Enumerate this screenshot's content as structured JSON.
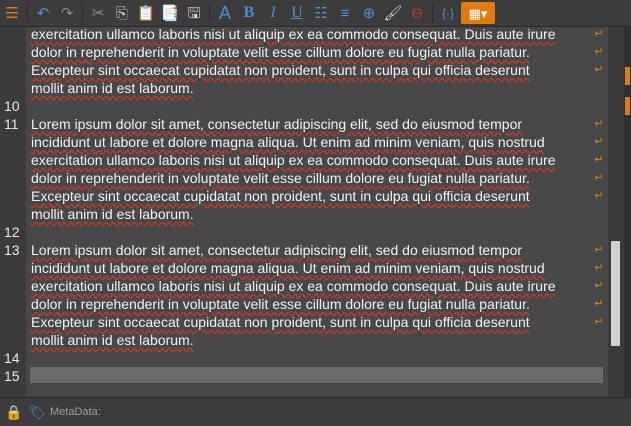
{
  "toolbar": {
    "items": [
      {
        "name": "menu-icon",
        "glyph": "☰"
      },
      {
        "name": "undo-icon",
        "glyph": "↶"
      },
      {
        "name": "redo-icon",
        "glyph": "↷"
      },
      {
        "name": "cut-icon",
        "glyph": "✂"
      },
      {
        "name": "copy-icon",
        "glyph": "⎘"
      },
      {
        "name": "paste-icon",
        "glyph": "📋"
      },
      {
        "name": "paste-special-icon",
        "glyph": "📑"
      },
      {
        "name": "save-icon",
        "glyph": "🖫"
      },
      {
        "name": "font-icon",
        "glyph": "A"
      },
      {
        "name": "bold-icon",
        "glyph": "B"
      },
      {
        "name": "italic-icon",
        "glyph": "I"
      },
      {
        "name": "underline-icon",
        "glyph": "U"
      },
      {
        "name": "bulleted-list-icon",
        "glyph": "☷"
      },
      {
        "name": "align-icon",
        "glyph": "≡"
      },
      {
        "name": "add-icon",
        "glyph": "⊕"
      },
      {
        "name": "brush-icon",
        "glyph": "🖌"
      },
      {
        "name": "stop-icon",
        "glyph": "⊖"
      },
      {
        "name": "brackets-icon",
        "glyph": "{·}"
      },
      {
        "name": "view-options-icon",
        "glyph": "▦▾"
      }
    ]
  },
  "editor": {
    "lines": [
      {
        "num": "",
        "text": "exercitation ullamco laboris nisi ut aliquip ex ea commodo consequat. Duis aute irure",
        "wrap": true
      },
      {
        "num": "",
        "text": "dolor in reprehenderit in voluptate velit esse cillum dolore eu fugiat nulla pariatur.",
        "wrap": true
      },
      {
        "num": "",
        "text": "Excepteur sint occaecat cupidatat non proident, sunt in culpa qui officia deserunt",
        "wrap": true
      },
      {
        "num": "",
        "text": "mollit anim id est laborum.",
        "wrap": false
      },
      {
        "num": "10",
        "text": "",
        "wrap": false
      },
      {
        "num": "11",
        "text": "Lorem ipsum dolor sit amet, consectetur adipiscing elit, sed do eiusmod tempor",
        "wrap": true
      },
      {
        "num": "",
        "text": "incididunt ut labore et dolore magna aliqua. Ut enim ad minim veniam, quis nostrud",
        "wrap": true
      },
      {
        "num": "",
        "text": "exercitation ullamco laboris nisi ut aliquip ex ea commodo consequat. Duis aute irure",
        "wrap": true
      },
      {
        "num": "",
        "text": "dolor in reprehenderit in voluptate velit esse cillum dolore eu fugiat nulla pariatur.",
        "wrap": true
      },
      {
        "num": "",
        "text": "Excepteur sint occaecat cupidatat non proident, sunt in culpa qui officia deserunt",
        "wrap": true
      },
      {
        "num": "",
        "text": "mollit anim id est laborum.",
        "wrap": false
      },
      {
        "num": "12",
        "text": "",
        "wrap": false
      },
      {
        "num": "13",
        "text": "Lorem ipsum dolor sit amet, consectetur adipiscing elit, sed do eiusmod tempor",
        "wrap": true
      },
      {
        "num": "",
        "text": "incididunt ut labore et dolore magna aliqua. Ut enim ad minim veniam, quis nostrud",
        "wrap": true
      },
      {
        "num": "",
        "text": "exercitation ullamco laboris nisi ut aliquip ex ea commodo consequat. Duis aute irure",
        "wrap": true
      },
      {
        "num": "",
        "text": "dolor in reprehenderit in voluptate velit esse cillum dolore eu fugiat nulla pariatur.",
        "wrap": true
      },
      {
        "num": "",
        "text": "Excepteur sint occaecat cupidatat non proident, sunt in culpa qui officia deserunt",
        "wrap": true
      },
      {
        "num": "",
        "text": "mollit anim id est laborum.",
        "wrap": false
      },
      {
        "num": "14",
        "text": "",
        "wrap": false
      },
      {
        "num": "15",
        "text": "",
        "wrap": false
      }
    ],
    "wrap_glyph": "↵"
  },
  "statusbar": {
    "meta_label": "MetaData:",
    "lock_icon": "🔒",
    "tag_icon": "🏷"
  },
  "colors": {
    "accent": "#e07b14",
    "spellcheck": "#c0392b"
  }
}
